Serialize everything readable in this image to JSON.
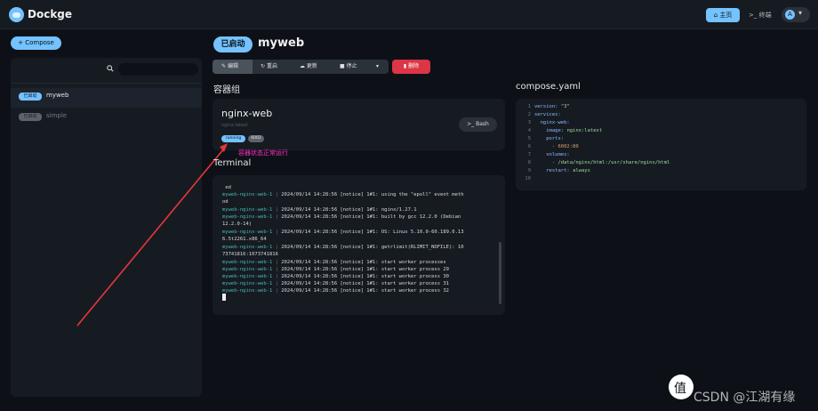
{
  "app": {
    "brand": "Dockge"
  },
  "header": {
    "home_label": "主页",
    "console_label": "终端",
    "avatar_letter": "A",
    "avatar_caret": "▾"
  },
  "sidebar": {
    "compose_button": "+ Compose",
    "search_placeholder": "",
    "stacks": [
      {
        "status": "已启动",
        "name": "myweb",
        "active": true,
        "status_color": "#74c2ff"
      },
      {
        "status": "已启动",
        "name": "simple",
        "active": false,
        "status_color": "#8a9099"
      }
    ]
  },
  "stack": {
    "status": "已启动",
    "name": "myweb",
    "toolbar": {
      "edit": "编辑",
      "restart": "重启",
      "update": "更新",
      "stop": "停止",
      "more": "▾"
    },
    "delete_label": "删除"
  },
  "containers": {
    "title": "容器组",
    "items": [
      {
        "name": "nginx-web",
        "image": "nginx:latest",
        "state": "running",
        "port": "6002",
        "bash_label": "Bash"
      }
    ],
    "annotation": "容器状态正常运行"
  },
  "terminal": {
    "title": "Terminal",
    "lines": [
      {
        "svc": "",
        "text": "ed"
      },
      {
        "svc": "myweb-nginx-web-1",
        "text": "2024/09/14 14:28:56 [notice] 1#1: using the \"epoll\" event meth"
      },
      {
        "svc": "",
        "text": "od"
      },
      {
        "svc": "myweb-nginx-web-1",
        "text": "2024/09/14 14:28:56 [notice] 1#1: nginx/1.27.1"
      },
      {
        "svc": "myweb-nginx-web-1",
        "text": "2024/09/14 14:28:56 [notice] 1#1: built by gcc 12.2.0 (Debian"
      },
      {
        "svc": "",
        "text": "12.2.0-14)"
      },
      {
        "svc": "myweb-nginx-web-1",
        "text": "2024/09/14 14:28:56 [notice] 1#1: OS: Linux 5.10.0-60.189.0.13"
      },
      {
        "svc": "",
        "text": "6.5t2261.x86_64"
      },
      {
        "svc": "myweb-nginx-web-1",
        "text": "2024/09/14 14:28:56 [notice] 1#1: getrlimit(RLIMIT_NOFILE): 10"
      },
      {
        "svc": "",
        "text": "73741816:1073741816"
      },
      {
        "svc": "myweb-nginx-web-1",
        "text": "2024/09/14 14:28:56 [notice] 1#1: start worker processes"
      },
      {
        "svc": "myweb-nginx-web-1",
        "text": "2024/09/14 14:28:56 [notice] 1#1: start worker process 29"
      },
      {
        "svc": "myweb-nginx-web-1",
        "text": "2024/09/14 14:28:56 [notice] 1#1: start worker process 30"
      },
      {
        "svc": "myweb-nginx-web-1",
        "text": "2024/09/14 14:28:56 [notice] 1#1: start worker process 31"
      },
      {
        "svc": "myweb-nginx-web-1",
        "text": "2024/09/14 14:28:56 [notice] 1#1: start worker process 32"
      }
    ]
  },
  "compose": {
    "title": "compose.yaml",
    "lines": [
      {
        "n": "1",
        "indent": "",
        "key": "version:",
        "val": "\"3\"",
        "type": "v"
      },
      {
        "n": "2",
        "indent": "",
        "key": "services:",
        "val": "",
        "type": "v"
      },
      {
        "n": "3",
        "indent": "  ",
        "key": "nginx-web:",
        "val": "",
        "type": "v"
      },
      {
        "n": "4",
        "indent": "    ",
        "key": "image:",
        "val": "nginx:latest",
        "type": "v"
      },
      {
        "n": "5",
        "indent": "    ",
        "key": "ports:",
        "val": "",
        "type": "v"
      },
      {
        "n": "6",
        "indent": "      ",
        "key": "- ",
        "val": "6002:80",
        "type": "n"
      },
      {
        "n": "7",
        "indent": "    ",
        "key": "volumes:",
        "val": "",
        "type": "v"
      },
      {
        "n": "8",
        "indent": "      ",
        "key": "- ",
        "val": "/data/nginx/html:/usr/share/nginx/html",
        "type": "v"
      },
      {
        "n": "9",
        "indent": "    ",
        "key": "restart:",
        "val": "always",
        "type": "v"
      },
      {
        "n": "10",
        "indent": "",
        "key": "",
        "val": "",
        "type": "v"
      }
    ]
  },
  "watermark": "CSDN @江湖有缘"
}
